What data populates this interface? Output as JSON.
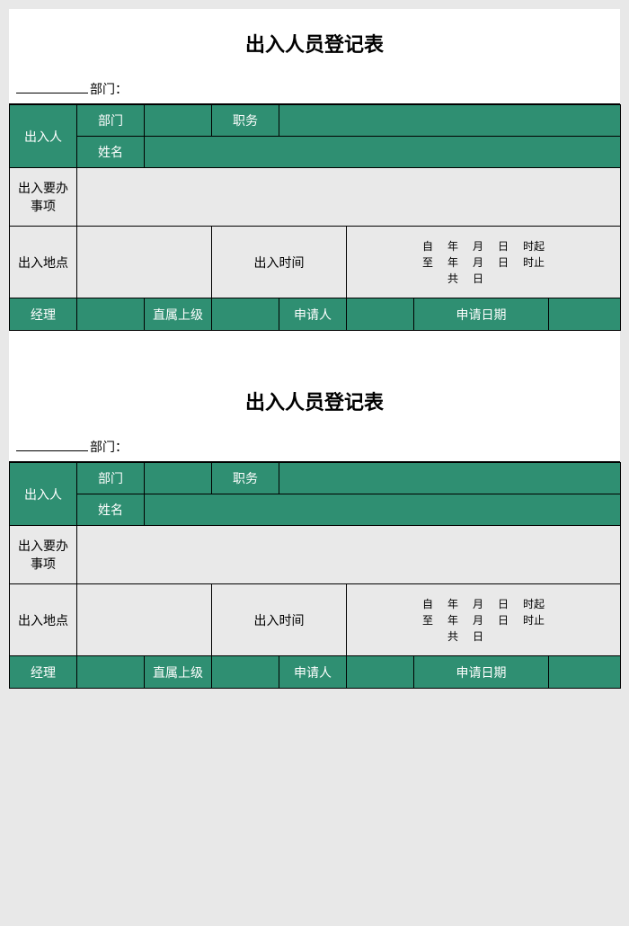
{
  "form": {
    "title": "出入人员登记表",
    "dept_label": "部门：",
    "person_label": "出入人",
    "person_dept": "部门",
    "person_position": "职务",
    "person_name": "姓名",
    "matters_label": "出入要办\n事项",
    "location_label": "出入地点",
    "time_label": "出入时间",
    "time_from": "自",
    "time_to": "至",
    "time_year": "年",
    "time_month": "月",
    "time_day": "日",
    "time_hour_start": "时起",
    "time_hour_end": "时止",
    "time_total": "共",
    "sig_manager": "经理",
    "sig_supervisor": "直属上级",
    "sig_applicant": "申请人",
    "sig_date": "申请日期"
  }
}
